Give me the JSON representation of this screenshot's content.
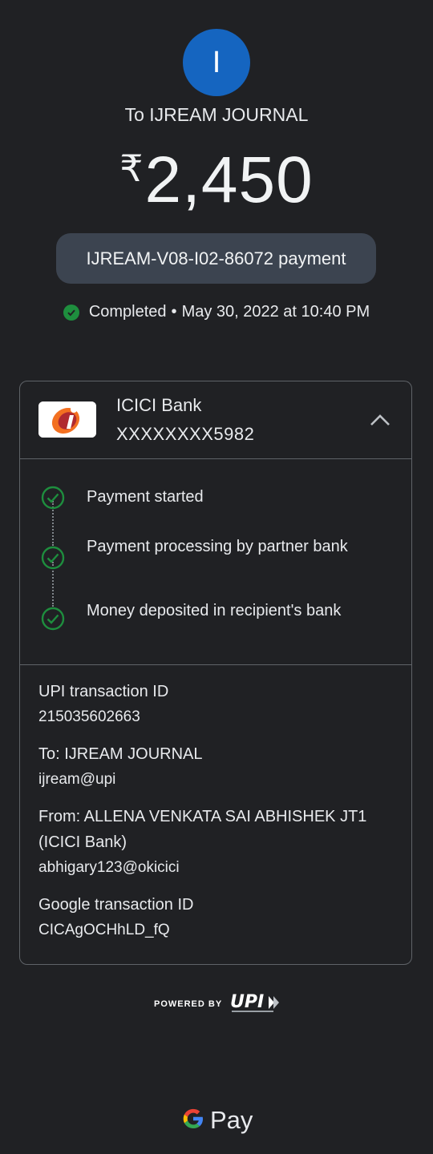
{
  "header": {
    "avatar_letter": "I",
    "payee": "To IJREAM JOURNAL",
    "currency_symbol": "₹",
    "amount": "2,450",
    "note": "IJREAM-V08-I02-86072 payment",
    "status": "Completed",
    "status_separator": "•",
    "datetime": "May 30, 2022 at 10:40 PM"
  },
  "colors": {
    "background": "#202124",
    "avatar": "#1565c0",
    "note_pill": "#3c4450",
    "success_green": "#1e8e3e"
  },
  "bank": {
    "name": "ICICI Bank",
    "account": "XXXXXXXX5982",
    "logo_icon": "icici-logo-icon",
    "expand_icon": "chevron-up-icon"
  },
  "timeline": [
    {
      "label": "Payment started"
    },
    {
      "label": "Payment processing by partner bank"
    },
    {
      "label": "Money deposited in recipient's bank"
    }
  ],
  "details": {
    "upi_id_label": "UPI transaction ID",
    "upi_id_value": "215035602663",
    "to_label": "To: IJREAM JOURNAL",
    "to_value": "ijream@upi",
    "from_label": "From: ALLENA VENKATA SAI ABHISHEK JT1 (ICICI Bank)",
    "from_value": "abhigary123@okicici",
    "google_id_label": "Google transaction ID",
    "google_id_value": "CICAgOCHhLD_fQ"
  },
  "footer": {
    "powered_by": "POWERED BY",
    "upi_logo_text": "UPI",
    "gpay_text": "Pay"
  }
}
